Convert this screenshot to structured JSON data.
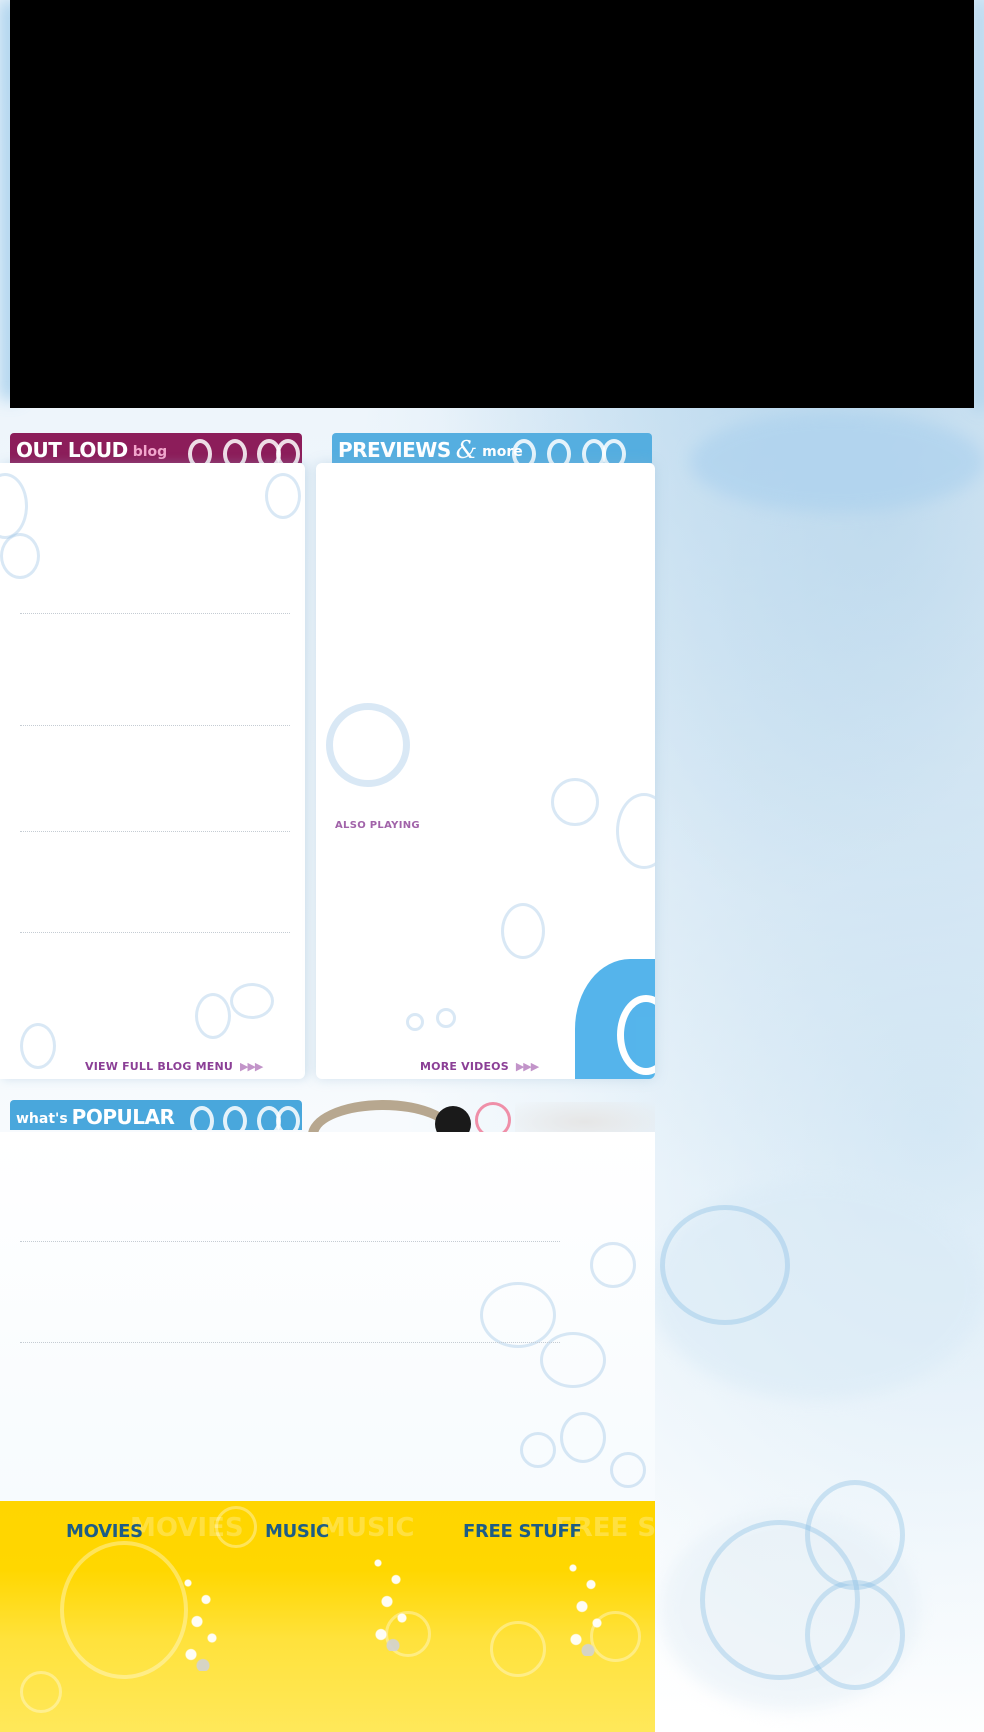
{
  "blog": {
    "title": "OUT LOUD",
    "subtitle": "blog",
    "link_label": "VIEW FULL BLOG MENU",
    "link_arrows": "▶▶▶"
  },
  "previews": {
    "title": "PREVIEWS",
    "ampersand": "&",
    "subtitle": "more",
    "also_playing": "ALSO PLAYING",
    "link_label": "MORE VIDEOS",
    "link_arrows": "▶▶▶"
  },
  "popular": {
    "prefix": "what's",
    "title": "POPULAR"
  },
  "footer_nav": {
    "items": [
      {
        "label": "MOVIES"
      },
      {
        "label": "MUSIC"
      },
      {
        "label": "FREE STUFF"
      }
    ]
  },
  "colors": {
    "blog_header": "#8c1d5a",
    "previews_header": "#55aee0",
    "popular_header": "#49a7dc",
    "footer_yellow": "#ffd500",
    "nav_text": "#1d5d86",
    "link_purple": "#8b3f96"
  }
}
